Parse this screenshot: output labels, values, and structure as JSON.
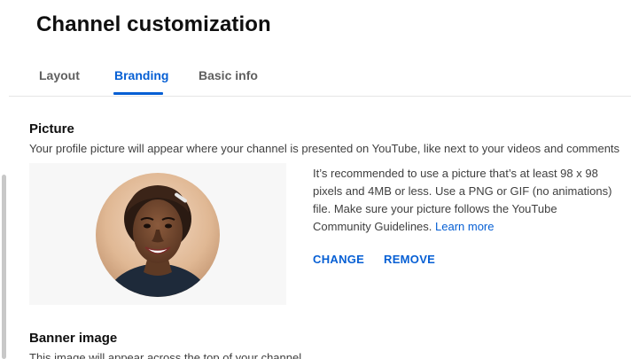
{
  "header": {
    "title": "Channel customization"
  },
  "tabs": [
    {
      "label": "Layout",
      "active": false
    },
    {
      "label": "Branding",
      "active": true
    },
    {
      "label": "Basic info",
      "active": false
    }
  ],
  "picture": {
    "title": "Picture",
    "description": "Your profile picture will appear where your channel is presented on YouTube, like next to your videos and comments",
    "recommendation": "It’s recommended to use a picture that’s at least 98 x 98 pixels and 4MB or less. Use a PNG or GIF (no animations) file. Make sure your picture follows the YouTube Community Guidelines.",
    "learn_more": "Learn more",
    "change_label": "CHANGE",
    "remove_label": "REMOVE"
  },
  "banner": {
    "title": "Banner image",
    "description": "This image will appear across the top of your channel"
  },
  "colors": {
    "accent": "#065fd4",
    "text_primary": "#0f0f0f",
    "text_secondary": "#3f3f3f",
    "preview_bg": "#f7f7f7"
  }
}
